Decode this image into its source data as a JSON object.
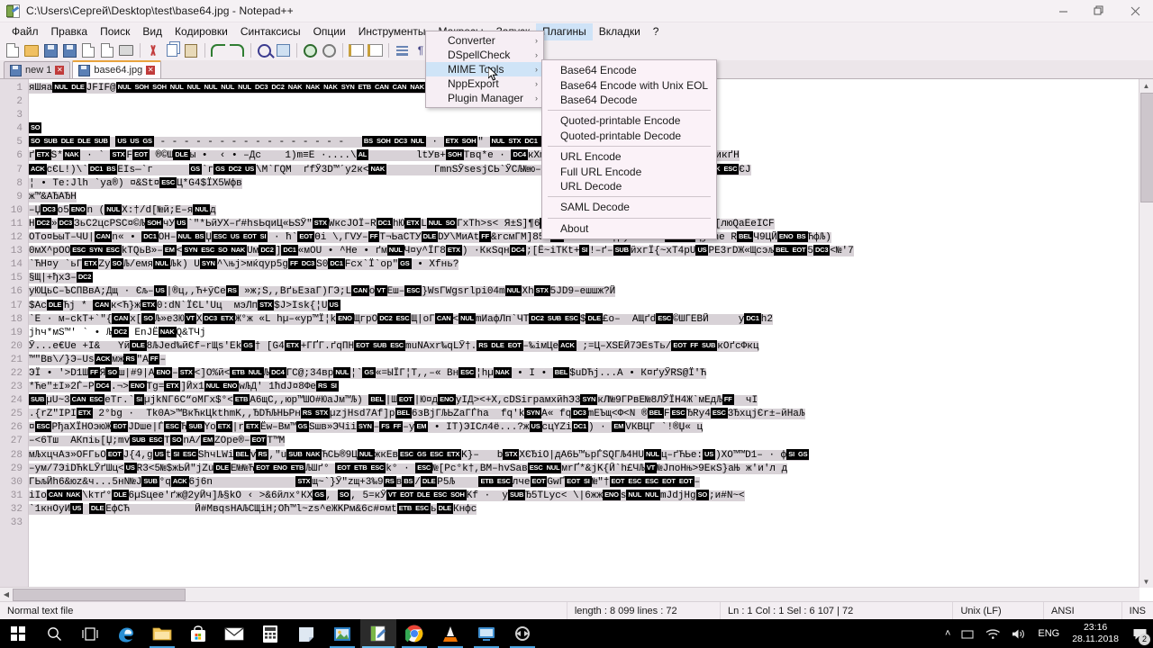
{
  "window": {
    "title": "C:\\Users\\Сергей\\Desktop\\test\\base64.jpg - Notepad++",
    "minimize": "–",
    "restore": "❐",
    "close": "✕"
  },
  "menubar": {
    "items": [
      {
        "label": "Файл"
      },
      {
        "label": "Правка"
      },
      {
        "label": "Поиск"
      },
      {
        "label": "Вид"
      },
      {
        "label": "Кодировки"
      },
      {
        "label": "Синтаксисы"
      },
      {
        "label": "Опции"
      },
      {
        "label": "Инструменты"
      },
      {
        "label": "Макросы"
      },
      {
        "label": "Запуск"
      },
      {
        "label": "Плагины",
        "active": true
      },
      {
        "label": "Вкладки"
      },
      {
        "label": "?"
      }
    ]
  },
  "toolbar": {
    "icons": [
      "new-file-icon",
      "open-file-icon",
      "save-icon",
      "save-all-icon",
      "close-file-icon",
      "close-all-icon",
      "print-icon",
      "cut-icon",
      "copy-icon",
      "paste-icon",
      "undo-icon",
      "redo-icon",
      "find-icon",
      "replace-icon",
      "zoom-in-icon",
      "zoom-out-icon",
      "sync-vertical-icon",
      "sync-horizontal-icon",
      "word-wrap-icon",
      "show-symbol-icon",
      "indent-guide-icon",
      "show-all-chars-icon",
      "user-defined-dialog-icon",
      "macro-record-icon",
      "abc-spellcheck-icon"
    ]
  },
  "tabs": [
    {
      "label": "new 1",
      "active": false,
      "close": "✕"
    },
    {
      "label": "base64.jpg",
      "active": true,
      "close": "✕"
    }
  ],
  "plugins_menu": {
    "items": [
      {
        "label": "Converter",
        "arrow": "›",
        "highlighted": false
      },
      {
        "label": "DSpellCheck",
        "arrow": "›",
        "highlighted": false
      },
      {
        "label": "MIME Tools",
        "arrow": "›",
        "highlighted": true
      },
      {
        "label": "NppExport",
        "arrow": "›",
        "highlighted": false
      },
      {
        "label": "Plugin Manager",
        "arrow": "›",
        "highlighted": false
      }
    ]
  },
  "mime_submenu": {
    "groups": [
      [
        "Base64 Encode",
        "Base64 Encode with Unix EOL",
        "Base64 Decode"
      ],
      [
        "Quoted-printable Encode",
        "Quoted-printable Decode"
      ],
      [
        "URL Encode",
        "Full URL Encode",
        "URL Decode"
      ],
      [
        "SAML Decode"
      ],
      [
        "About"
      ]
    ]
  },
  "statusbar": {
    "file_type": "Normal text file",
    "length_lines": "length : 8 099    lines : 72",
    "position": "Ln : 1    Col : 1    Sel : 6 107 | 72",
    "eol": "Unix (LF)",
    "encoding": "ANSI",
    "insert_mode": "INS"
  },
  "editor": {
    "total_lines": 33,
    "lines": [
      {
        "n": 1,
        "text": "яШяа@NUL@@DLE@JFIF@@NUL@@SOH@@SOH@@NUL@@NUL@@NUL@@NUL@@NUL@@DC3@@DC2@@NAK@@NAK@@NAK@@SYN@@ETB@@CAN@@CAN@@NAK@@CAN@@ETB@@ETB@@NAK@@CAN@",
        "sel": true
      },
      {
        "n": 2,
        "text": "",
        "sel": false
      },
      {
        "n": 3,
        "text": "",
        "sel": false
      },
      {
        "n": 4,
        "text": "@SO@",
        "sel": true
      },
      {
        "n": 5,
        "text": "@SO@@SUB@@DLE@@DLE@@SUB@ @US@@US@@GS@ - - - - - - - - - - - - - - - -   @BS@@SOH@@DC3@@NUL@ · @ETX@@SOH@\" @NUL@@STX@@DC1@@SOH@@ETX@@DC1@@SOH@ядNUL@",
        "sel": true
      },
      {
        "n": 6,
        "text": "ґ@ETX@S*@NAK@ · ` @STX@F@EOT@ ®©Ш@DLE@ы •  ‹ • –Дс    1)m≡E ·....\\@AL@        ltУв+@SOH@Твq*е · @DC4@кХm~#ХQ, @DC3@йс [@DLE@ ««гВ–ДгьСЉшникґН",
        "sel": true
      },
      {
        "n": 7,
        "text": "@ACK@сЄL!)\\`@DC1@@BS@EIs—`г      @GS@`г@GS@@DC2@@US@\\М`ГQМ  ґfЎ3D™´y2к<@NAK@        ГmnSЎsesjСЬ`ЎСЉ№ю–&@DLE@ · [@SYN@\\еs`@DC1@iiGWЋhj · @NAK@@ESC@ЄЈ",
        "sel": true
      },
      {
        "n": 8,
        "text": "¦ • Te:Jlh `ya®) ¤&St¤@ESC@Ц*G4$ЇX5Wфв",
        "sel": true
      },
      {
        "n": 9,
        "text": "ж™&АЂАЂН",
        "sel": true
      },
      {
        "n": 10,
        "text": "–Џ@DC3@o5@ENO@n (@NUL@X:†/d[№й;Е–я@NUL@д",
        "sel": true
      },
      {
        "n": 11,
        "text": "Н@DC2@»@DC3@ЗьС2цсРSС¤©Љ@SOH@чУ@US@`\"*ЬйУХ–ґ#hsЬqиЦ«ЬSЎ\"@STX@WкcJOЇ–R@DC1@hЮ@ETX@L@NUL@@SO@ГхTh>s< Я±S]¶6@DC3@цҐЉ»e%\\я@NUL@@BS@эая@NUL@Џt@DLE@аёЬ[люQaEeICF",
        "sel": true
      },
      {
        "n": 12,
        "text": "OTo¤ЬыT–ЧU|@CAN@n« • @DC1@OH–@NUL@@BS@Џ@ESC@@US@@EOT@@SI@ · ћ`@EOT@Өi \\,ГVУ–@FF@Т¬ЬaCTУ@DLE@DУ\\МиAt@FF@&rcмГM]85Љ@EM@№NГИ\\ћ >¦µуzЕЮ b–@EM@@ESC@ЦjUhe R@BEL@Ч9ЦЙ@ENO@@BS@ЋфЉ)",
        "sel": true
      },
      {
        "n": 13,
        "text": "0мХ^pOO@ESC@@SYN@@ESC@kТQьВ»–@EM@<@SYN@@ESC@@SO@@NAK@Uм@DC2@]@DC1@«мOU • ^He • ґм@NUL@Ч¤у^ЇГ8@ETX@) ·КкSqн@DC4@;[Ё~iTКt+@SI@!–ґ–@SUB@йхгЇ{~xT4pU@US@PE3rDЖ«Щсэљ@BEL@@EOT@5@DC3@<№'7",
        "sel": true
      },
      {
        "n": 14,
        "text": "`ЋН¤у `ьГ@ETX@Zу@SO@Љ/емя@NUL@Љk) U@SYN@^\\њj>мќqур5g@FF@@DC3@S0@DC1@Fcx`Ї`oр\"@GS@ • Хfнь?",
        "sel": true
      },
      {
        "n": 15,
        "text": "§Щ|+ђхЗ–@DC2@",
        "sel": true
      },
      {
        "n": 16,
        "text": "уЮЦьС–ЪСПВвА;Дщ · Єљ–@US@|®ц,,Ћ+ўСе@RS@ »ж;S,,ВґьЕзаГ)ГЭ;L@CAN@o@VT@Еш–@ESC@}WsГWgsrlpi04m@NUL@Xh@STX@5JD9–ешшж?Й",
        "sel": true
      },
      {
        "n": 17,
        "text": "$Ac@DLE@Ћj * @CAN@к<Ћ}ж@ETX@0:dN`ЇЄL'Uц  мэЛп@STX@$Ј>Isk{¦U@US@",
        "sel": true
      },
      {
        "n": 18,
        "text": "`Е · м–ckТ+`\"{@CAN@x[@SO@Љ»е3Ю@VT@Х@DC3@@ETX@Ж°ж «L hµ–«ур™Ї¦k@ENO@ЩгрO@DC2@@ESC@Щ|оГ@CAN@<@NUL@mИафЛп`ЧТ@DC2@@SUB@@ESC@$@DLE@£о–  АЩґd@ESC@©ШГЕВЙ     y@DC1@h2",
        "sel": true
      },
      {
        "n": 19,
        "text": "jhч*мS™' ` • Љ@DC2@ EnJЁ@NAK@Q&TЧj",
        "sel": false
      },
      {
        "n": 20,
        "text": "Ў...e€Ue +I&   Yй@DLE@8ЉJed‰йЄf–rЩs'Ek@GS@† [G4@ETX@+ГҐГ.ґqПН@EOT@@SUB@@ESC@muNAxr‰qLЎ†.@RS@@DLE@@EOT@–‰iмЦe@ACK@ ;=Ц–XSЕЙ7ЭEsТь/@EOT@@FF@@SUB@кОґсФкц",
        "sel": true
      },
      {
        "n": 21,
        "text": "™\"Вв\\/}Э–Us@ACK@мж@RS@\"A@FF@–",
        "sel": true
      },
      {
        "n": 22,
        "text": "ЭЇ • '>D1Ш@FF@Я@SO@ш|#9|A@ENO@–@STX@<]O%й<@ETB@@NUL@Љ@DC4@ГC@;34вр@NUL@¦`@GS@«=ЫЇГ¦Т,,–« Вн@ESC@¦hµ@NAK@ • I • @BEL@$uDЋj...А • К¤ґуЎRS@Ї'Ћ",
        "sel": true
      },
      {
        "n": 23,
        "text": "*Ћe\"±I»2Ѓ–P@DC4@.¬>@ENO@Tg=@ETX@]Йx1@NUL@@ENO@wЉД' 1ћdJ¤8Фe@RS@@SI@",
        "sel": true
      },
      {
        "n": 24,
        "text": "@SUB@µU~3@CAN@@ESC@eTг.`@SI@µjkNГ6С“oMГx$°<@ETB@A6щC,,юр™ШO#ЮaJм™Љ) @BEL@|Ш@EOT@|Ю¤д@ENO@yIД><+X,cDSіграмхйhЭ3@SYN@кЛ№9ГРвЕ№8ЛЎЇН4Ж`мЕдЉ@FF@  чI",
        "sel": true
      },
      {
        "n": 25,
        "text": ".{rZ\"IPI@ETX@ 2°bg ·  Tk0A>™ВкЋкЦkthmK,,ЂDЋЉНЬРн@RS@@STX@µzjHsd7Af]р@BEL@6зBjГЉЬZaГЃha  fq'k@SYN@A« fq@DC3@mЕЪщ<Ф<N ®@BEL@F@ESC@ЂRy4@ESC@3ЂхцjЄr±–йНаЉ",
        "sel": true
      },
      {
        "n": 26,
        "text": "¤@ESC@РђaXЇНOэюЖ@EOT@JDшe|Ѓ@ESC@Ћ@SUB@Yo@ETX@|r@ETX@Ёw–Вм™@GS@Sшв»ЭЧii@SYN@–@FS@@FF@–y@EM@ • IT)ЭІCл4ё...?ж@US@сцYZi@DC1@) · @EM@VКВЦГ `!®Џ« ц",
        "sel": true
      },
      {
        "n": 27,
        "text": "–<6Tш  АКпiь[Џ;mv@SUB@@ESC@T@SO@nA/@EM@ZOpe®–@EOT@T™М",
        "sel": true
      },
      {
        "n": 28,
        "text": "мЉхцчАз»ОFГьО@EOT@J{4,g@US@t@SI@@ESC@ShчLWi@BEL@v@RS@,\"u@SUB@@NAK@ЋСЬ®9Ц@NUL@жкЕв@ESC@@GS@@ESC@@ETX@K}–   b@STX@XЄЂiO|дA6Ь™ьрЃSQГЉ4HU@NUL@ц–ґЋЬе:@US@)XO™™D1– · ф@SI@@GS@",
        "sel": true
      },
      {
        "n": 29,
        "text": "–ум/7ЭiDЋkLЎґШц<@US@R3<5№$жЬЙ\"jZu@DLE@Е№№Ћ@EOT@@ENO@@ETB@ЉШґ° @EOT@@ETB@@ESC@k° · @ESC@№[Pc°k†,ВМ–hvSaв@ESC@@NUL@мrҐ*&jK{Й`h£ЧЉ@VT@№ЈпоНњ>9ЕкЅ}aЊ ж'и'л д",
        "sel": true
      },
      {
        "n": 30,
        "text": "ГЬљЙh6&юz&ч...5нN№J@SUB@°q@ACK@6j6n              @STX@щ~`}Ў\"zщ+3‰9@RS@в@BS@/@DLE@P5Љ    @ETB@@ESC@лчe@EOT@GwҐ@EOT@@SI@№\"†@EOT@@ESC@@ESC@@EOT@@EOT@–",
        "sel": true
      },
      {
        "n": 31,
        "text": "iIo@CAN@@NAK@\\kтґ°@DLE@6µSцee'ґж@2уЙч]Љ§kO ‹ >&6йлх°КХ@GS@, @SO@, 5=кЎ@VT@@EOT@@DLE@@ESC@@SOH@Kf ·  у@SUB@Ђ5TLyc< \\|6жж@ENO@s@NUL@@NUL@mJdjHg@SO@;и#N~<",
        "sel": true
      },
      {
        "n": 32,
        "text": "`1кнOуИ@US@ @DLE@ЕфСЋ           Й#МвqsНАЉСЩiН;Oћ™l~zs^eЖKPм&6c#¤мt@ETB@@ESC@ь@DLE@Кнфс",
        "sel": true
      },
      {
        "n": 33,
        "text": "",
        "sel": false
      }
    ]
  },
  "taskbar": {
    "start_icon": "windows-logo-icon",
    "icons": [
      {
        "name": "search-icon"
      },
      {
        "name": "task-view-icon"
      },
      {
        "name": "edge-browser-icon"
      },
      {
        "name": "file-explorer-icon"
      },
      {
        "name": "microsoft-store-icon"
      },
      {
        "name": "mail-icon"
      },
      {
        "name": "calculator-icon"
      },
      {
        "name": "sticky-notes-icon"
      },
      {
        "name": "photos-icon"
      },
      {
        "name": "notepadpp-icon"
      },
      {
        "name": "chrome-icon"
      },
      {
        "name": "vlc-icon"
      },
      {
        "name": "remote-desktop-icon"
      },
      {
        "name": "teamviewer-icon"
      }
    ],
    "tray": {
      "show_hidden": "˄",
      "network_icon": "wifi-icon",
      "volume_icon": "volume-icon",
      "language": "ENG",
      "time": "23:16",
      "date": "28.11.2018",
      "notification_count": "2"
    }
  }
}
